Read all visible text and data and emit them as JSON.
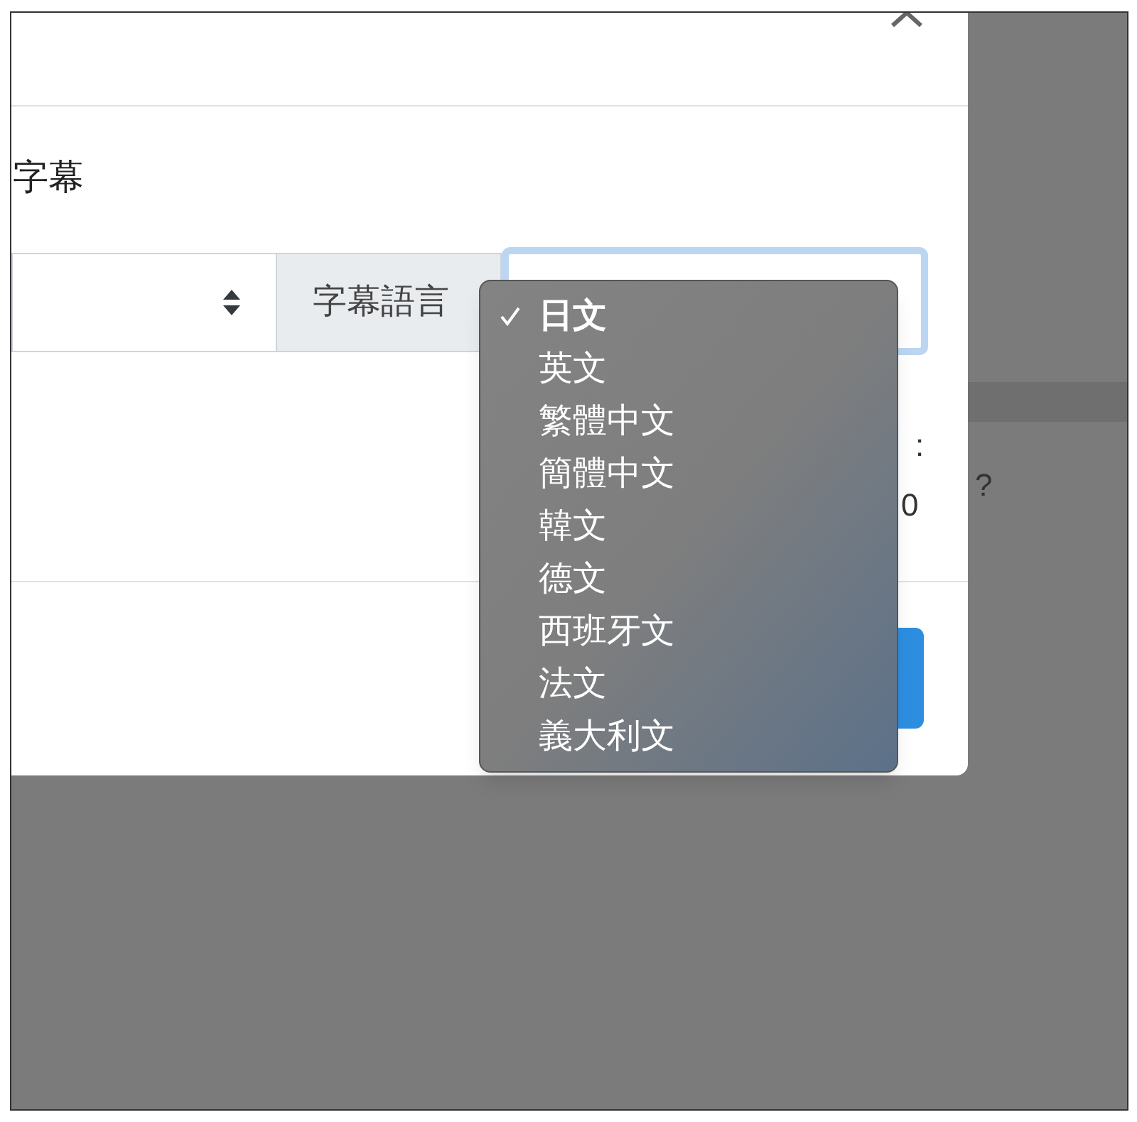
{
  "modal": {
    "heading": "字幕",
    "addon_label": "字幕語言",
    "hidden_texts": [
      ":",
      "0"
    ]
  },
  "background_texts": [
    "?"
  ],
  "language_menu": {
    "options": [
      {
        "label": "日文",
        "selected": true
      },
      {
        "label": "英文",
        "selected": false
      },
      {
        "label": "繁體中文",
        "selected": false
      },
      {
        "label": "簡體中文",
        "selected": false
      },
      {
        "label": "韓文",
        "selected": false
      },
      {
        "label": "德文",
        "selected": false
      },
      {
        "label": "西班牙文",
        "selected": false
      },
      {
        "label": "法文",
        "selected": false
      },
      {
        "label": "義大利文",
        "selected": false
      }
    ]
  }
}
